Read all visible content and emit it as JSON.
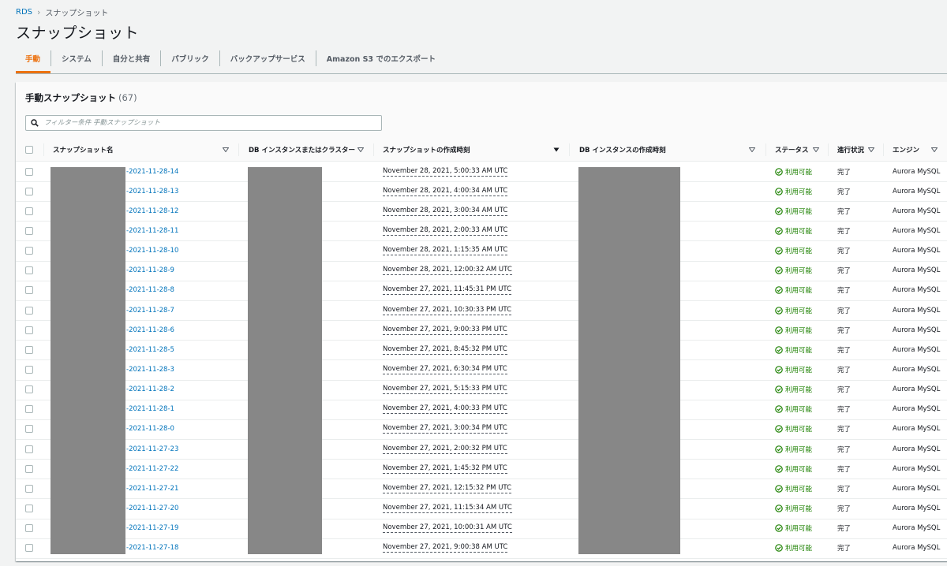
{
  "breadcrumb": {
    "root": "RDS",
    "current": "スナップショット"
  },
  "page_title": "スナップショット",
  "tabs": [
    {
      "label": "手動",
      "active": true
    },
    {
      "label": "システム",
      "active": false
    },
    {
      "label": "自分と共有",
      "active": false
    },
    {
      "label": "パブリック",
      "active": false
    },
    {
      "label": "バックアップサービス",
      "active": false
    },
    {
      "label": "Amazon S3 でのエクスポート",
      "active": false
    }
  ],
  "panel": {
    "title": "手動スナップショット",
    "count": "(67)",
    "search_placeholder": "フィルター条件 手動スナップショット"
  },
  "columns": {
    "name": "スナップショット名",
    "instance": "DB インスタンスまたはクラスター",
    "snapshot_time": "スナップショットの作成時刻",
    "instance_time": "DB インスタンスの作成時刻",
    "status": "ステータス",
    "progress": "進行状況",
    "engine": "エンジン"
  },
  "rows": [
    {
      "name": "-2021-11-28-14",
      "snapshot_time": "November 28, 2021, 5:00:33 AM UTC",
      "status": "利用可能",
      "progress": "完了",
      "engine": "Aurora MySQL"
    },
    {
      "name": "-2021-11-28-13",
      "snapshot_time": "November 28, 2021, 4:00:34 AM UTC",
      "status": "利用可能",
      "progress": "完了",
      "engine": "Aurora MySQL"
    },
    {
      "name": "-2021-11-28-12",
      "snapshot_time": "November 28, 2021, 3:00:34 AM UTC",
      "status": "利用可能",
      "progress": "完了",
      "engine": "Aurora MySQL"
    },
    {
      "name": "-2021-11-28-11",
      "snapshot_time": "November 28, 2021, 2:00:33 AM UTC",
      "status": "利用可能",
      "progress": "完了",
      "engine": "Aurora MySQL"
    },
    {
      "name": "-2021-11-28-10",
      "snapshot_time": "November 28, 2021, 1:15:35 AM UTC",
      "status": "利用可能",
      "progress": "完了",
      "engine": "Aurora MySQL"
    },
    {
      "name": "-2021-11-28-9",
      "snapshot_time": "November 28, 2021, 12:00:32 AM UTC",
      "status": "利用可能",
      "progress": "完了",
      "engine": "Aurora MySQL"
    },
    {
      "name": "-2021-11-28-8",
      "snapshot_time": "November 27, 2021, 11:45:31 PM UTC",
      "status": "利用可能",
      "progress": "完了",
      "engine": "Aurora MySQL"
    },
    {
      "name": "-2021-11-28-7",
      "snapshot_time": "November 27, 2021, 10:30:33 PM UTC",
      "status": "利用可能",
      "progress": "完了",
      "engine": "Aurora MySQL"
    },
    {
      "name": "-2021-11-28-6",
      "snapshot_time": "November 27, 2021, 9:00:33 PM UTC",
      "status": "利用可能",
      "progress": "完了",
      "engine": "Aurora MySQL"
    },
    {
      "name": "-2021-11-28-5",
      "snapshot_time": "November 27, 2021, 8:45:32 PM UTC",
      "status": "利用可能",
      "progress": "完了",
      "engine": "Aurora MySQL"
    },
    {
      "name": "-2021-11-28-3",
      "snapshot_time": "November 27, 2021, 6:30:34 PM UTC",
      "status": "利用可能",
      "progress": "完了",
      "engine": "Aurora MySQL"
    },
    {
      "name": "-2021-11-28-2",
      "snapshot_time": "November 27, 2021, 5:15:33 PM UTC",
      "status": "利用可能",
      "progress": "完了",
      "engine": "Aurora MySQL"
    },
    {
      "name": "-2021-11-28-1",
      "snapshot_time": "November 27, 2021, 4:00:33 PM UTC",
      "status": "利用可能",
      "progress": "完了",
      "engine": "Aurora MySQL"
    },
    {
      "name": "-2021-11-28-0",
      "snapshot_time": "November 27, 2021, 3:00:34 PM UTC",
      "status": "利用可能",
      "progress": "完了",
      "engine": "Aurora MySQL"
    },
    {
      "name": "-2021-11-27-23",
      "snapshot_time": "November 27, 2021, 2:00:32 PM UTC",
      "status": "利用可能",
      "progress": "完了",
      "engine": "Aurora MySQL"
    },
    {
      "name": "-2021-11-27-22",
      "snapshot_time": "November 27, 2021, 1:45:32 PM UTC",
      "status": "利用可能",
      "progress": "完了",
      "engine": "Aurora MySQL"
    },
    {
      "name": "-2021-11-27-21",
      "snapshot_time": "November 27, 2021, 12:15:32 PM UTC",
      "status": "利用可能",
      "progress": "完了",
      "engine": "Aurora MySQL"
    },
    {
      "name": "-2021-11-27-20",
      "snapshot_time": "November 27, 2021, 11:15:34 AM UTC",
      "status": "利用可能",
      "progress": "完了",
      "engine": "Aurora MySQL"
    },
    {
      "name": "-2021-11-27-19",
      "snapshot_time": "November 27, 2021, 10:00:31 AM UTC",
      "status": "利用可能",
      "progress": "完了",
      "engine": "Aurora MySQL"
    },
    {
      "name": "-2021-11-27-18",
      "snapshot_time": "November 27, 2021, 9:00:38 AM UTC",
      "status": "利用可能",
      "progress": "完了",
      "engine": "Aurora MySQL"
    }
  ],
  "colors": {
    "link": "#0073bb",
    "accent": "#ec7211",
    "status_ok": "#1d8102",
    "redaction": "#878787"
  }
}
